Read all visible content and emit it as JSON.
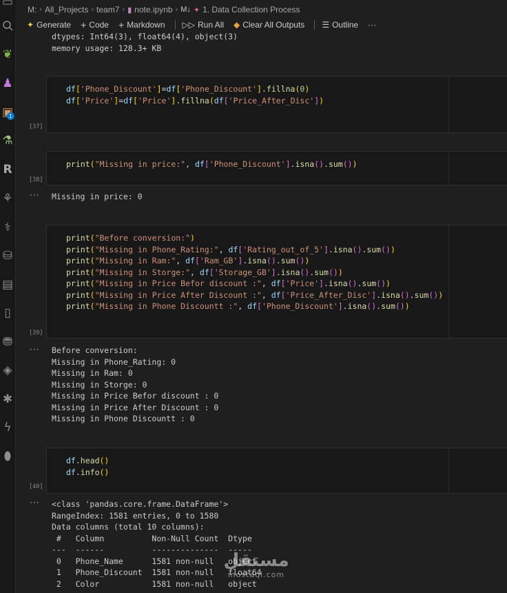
{
  "breadcrumb": {
    "drive": "M:",
    "folder1": "All_Projects",
    "folder2": "team7",
    "file": "note.ipynb",
    "md_marker": "M↓",
    "section": "1. Data Collection Process"
  },
  "toolbar": {
    "generate": "Generate",
    "code": "Code",
    "markdown": "Markdown",
    "run_all": "Run All",
    "clear_all": "Clear All Outputs",
    "outline": "Outline",
    "more": "···"
  },
  "notebook": {
    "prev_output": [
      "dtypes: Int64(3), float64(4), object(3)",
      "memory usage: 128.3+ KB"
    ],
    "cell37": {
      "count": "[37]"
    },
    "cell38": {
      "count": "[38]",
      "output": "Missing in price: 0"
    },
    "cell39": {
      "count": "[39]",
      "output": [
        "Before conversion:",
        "Missing in Phone_Rating: 0",
        "Missing in Ram: 0",
        "Missing in Storge: 0",
        "Missing in Price Befor discount : 0",
        "Missing in Price After Discount : 0",
        "Missing in Phone Discountt : 0"
      ]
    },
    "cell40": {
      "count": "[40]",
      "output": [
        "<class 'pandas.core.frame.DataFrame'>",
        "RangeIndex: 1581 entries, 0 to 1580",
        "Data columns (total 10 columns):",
        " #   Column          Non-Null Count  Dtype",
        "---  ------          --------------  -----",
        " 0   Phone_Name      1581 non-null   object",
        " 1   Phone_Discount  1581 non-null   float64",
        " 2   Color           1581 non-null   object"
      ]
    },
    "output_marker": "···"
  },
  "watermark": {
    "arabic": "مستقل",
    "latin": "mostaql.com"
  },
  "activity_icons": [
    "search-icon",
    "leaf-icon",
    "spy-icon",
    "package-icon",
    "test-tube-icon",
    "r-language-icon",
    "tree-icon",
    "python-icon",
    "database-icon",
    "server-icon",
    "notebook-icon",
    "database-stack-icon",
    "layers-icon",
    "bug-icon",
    "lightning-icon",
    "mongo-leaf-icon"
  ],
  "activity_badge": "1"
}
